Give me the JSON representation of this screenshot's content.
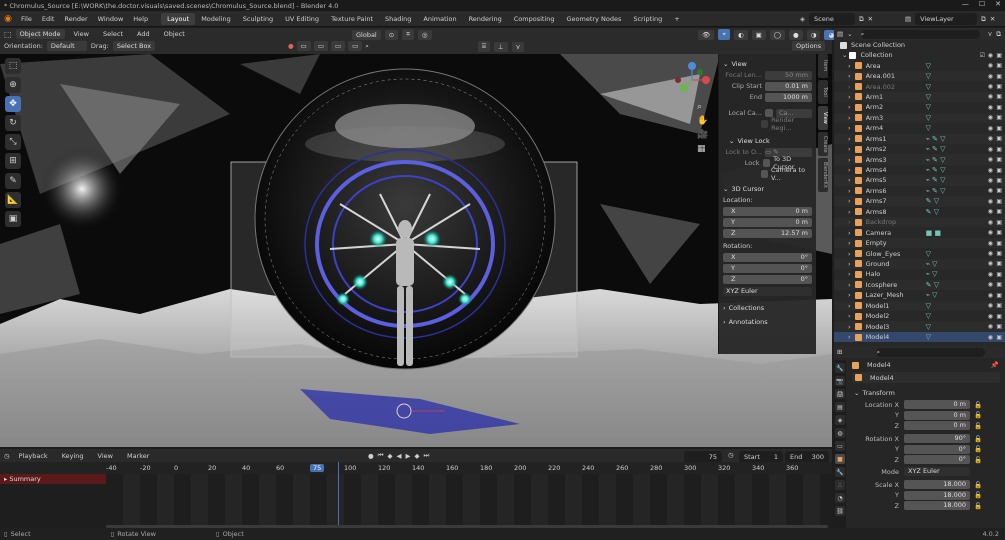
{
  "window": {
    "title": "* Chromulus_Source [E:\\WORK\\the.doctor.visuals\\saved.scenes\\Chromulus_Source.blend] - Blender 4.0"
  },
  "menu": [
    "File",
    "Edit",
    "Render",
    "Window",
    "Help"
  ],
  "workspaces": [
    "Layout",
    "Modeling",
    "Sculpting",
    "UV Editing",
    "Texture Paint",
    "Shading",
    "Animation",
    "Rendering",
    "Compositing",
    "Geometry Nodes",
    "Scripting"
  ],
  "add_workspace": "+",
  "scene": {
    "label": "Scene",
    "view_layer": "ViewLayer"
  },
  "viewport_header": {
    "mode": "Object Mode",
    "view": "View",
    "select": "Select",
    "add": "Add",
    "object": "Object",
    "transform_orientation": "Global",
    "orientation_label": "Orientation:",
    "orientation_value": "Default",
    "drag_label": "Drag:",
    "drag_value": "Select Box",
    "options": "Options"
  },
  "npanel": {
    "view_header": "View",
    "focal_length_label": "Focal Len...",
    "focal_length": "50 mm",
    "clip_start_label": "Clip Start",
    "clip_start": "0.01 m",
    "clip_end_label": "End",
    "clip_end": "1000 m",
    "local_camera_label": "Local Ca...",
    "local_camera": "Ca...",
    "render_region": "Render Regi...",
    "view_lock_header": "View Lock",
    "lock_to_object_label": "Lock to O...",
    "lock_label": "Lock",
    "to_3d_cursor": "To 3D Cursor",
    "camera_to_view": "Camera to V...",
    "cursor_header": "3D Cursor",
    "location_label": "Location:",
    "cursor_x": "0 m",
    "cursor_y": "0 m",
    "cursor_z": "12.57 m",
    "rotation_label": "Rotation:",
    "rot_x": "0°",
    "rot_y": "0°",
    "rot_z": "0°",
    "rotation_mode": "XYZ Euler",
    "collections_header": "Collections",
    "annotations_header": "Annotations",
    "axis_x": "X",
    "axis_y": "Y",
    "axis_z": "Z"
  },
  "ntabs": [
    "Item",
    "Tool",
    "View",
    "Create",
    "BlenderKit"
  ],
  "timeline": {
    "playback": "Playback",
    "keying": "Keying",
    "view": "View",
    "marker": "Marker",
    "current_frame": "75",
    "start_label": "Start",
    "start": "1",
    "end_label": "End",
    "end": "300",
    "ruler": [
      "-40",
      "-20",
      "0",
      "20",
      "40",
      "60",
      "75",
      "100",
      "120",
      "140",
      "160",
      "180",
      "200",
      "220",
      "240",
      "260",
      "280",
      "300",
      "320",
      "340",
      "360"
    ],
    "summary": "Summary"
  },
  "outliner": {
    "root": "Scene Collection",
    "collection": "Collection",
    "items": [
      {
        "name": "Area",
        "color": "#e8a15a",
        "mods": "▽",
        "disabled": false
      },
      {
        "name": "Area.001",
        "color": "#e8a15a",
        "mods": "▽",
        "disabled": false
      },
      {
        "name": "Area.002",
        "color": "#e8a15a",
        "mods": "▽",
        "disabled": true
      },
      {
        "name": "Arm1",
        "color": "#e8a15a",
        "mods": "▽",
        "disabled": false
      },
      {
        "name": "Arm2",
        "color": "#e8a15a",
        "mods": "▽",
        "disabled": false
      },
      {
        "name": "Arm3",
        "color": "#e8a15a",
        "mods": "▽",
        "disabled": false
      },
      {
        "name": "Arm4",
        "color": "#e8a15a",
        "mods": "▽",
        "disabled": false
      },
      {
        "name": "Arms1",
        "color": "#e8a15a",
        "mods": "⌁ ✎ ▽",
        "disabled": false
      },
      {
        "name": "Arms2",
        "color": "#e8a15a",
        "mods": "⌁ ✎ ▽",
        "disabled": false
      },
      {
        "name": "Arms3",
        "color": "#e8a15a",
        "mods": "⌁ ✎ ▽",
        "disabled": false
      },
      {
        "name": "Arms4",
        "color": "#e8a15a",
        "mods": "⌁ ✎ ▽",
        "disabled": false
      },
      {
        "name": "Arms5",
        "color": "#e8a15a",
        "mods": "⌁ ✎ ▽",
        "disabled": false
      },
      {
        "name": "Arms6",
        "color": "#e8a15a",
        "mods": "⌁ ✎ ▽",
        "disabled": false
      },
      {
        "name": "Arms7",
        "color": "#e8a15a",
        "mods": "✎ ▽",
        "disabled": false
      },
      {
        "name": "Arms8",
        "color": "#e8a15a",
        "mods": "✎ ▽",
        "disabled": false
      },
      {
        "name": "Backdrop",
        "color": "#e8a15a",
        "mods": "",
        "disabled": true
      },
      {
        "name": "Camera",
        "color": "#e8a15a",
        "mods": "■ ■",
        "disabled": false
      },
      {
        "name": "Empty",
        "color": "#e8a15a",
        "mods": "",
        "disabled": false
      },
      {
        "name": "Glow_Eyes",
        "color": "#e8a15a",
        "mods": "▽",
        "disabled": false
      },
      {
        "name": "Ground",
        "color": "#e8a15a",
        "mods": "⌁ ▽",
        "disabled": false
      },
      {
        "name": "Halo",
        "color": "#e8a15a",
        "mods": "⌁ ▽",
        "disabled": false
      },
      {
        "name": "Icosphere",
        "color": "#e8a15a",
        "mods": "✎ ▽",
        "disabled": false
      },
      {
        "name": "Lazer_Mesh",
        "color": "#e8a15a",
        "mods": "⌁ ▽",
        "disabled": false
      },
      {
        "name": "Model1",
        "color": "#e8a15a",
        "mods": "▽",
        "disabled": false
      },
      {
        "name": "Model2",
        "color": "#e8a15a",
        "mods": "▽",
        "disabled": false
      },
      {
        "name": "Model3",
        "color": "#e8a15a",
        "mods": "▽",
        "disabled": false
      },
      {
        "name": "Model4",
        "color": "#e8a15a",
        "mods": "▽",
        "disabled": false,
        "selected": true
      }
    ]
  },
  "properties": {
    "object_name": "Model4",
    "object_field": "Model4",
    "transform_header": "Transform",
    "location_x_label": "Location X",
    "location_x": "0 m",
    "location_y": "0 m",
    "location_z": "0 m",
    "rotation_x_label": "Rotation X",
    "rotation_x": "90°",
    "rotation_y": "0°",
    "rotation_z": "0°",
    "mode_label": "Mode",
    "mode": "XYZ Euler",
    "scale_x_label": "Scale X",
    "scale_x": "18.000",
    "scale_y": "18.000",
    "scale_z": "18.000",
    "y_label": "Y",
    "z_label": "Z"
  },
  "statusbar": {
    "select": "Select",
    "rotate": "Rotate View",
    "object": "Object",
    "version": "4.0.2"
  },
  "colors": {
    "accent": "#4772b3",
    "selected_row": "#33486b",
    "highlight_frame": "#4772b3"
  }
}
